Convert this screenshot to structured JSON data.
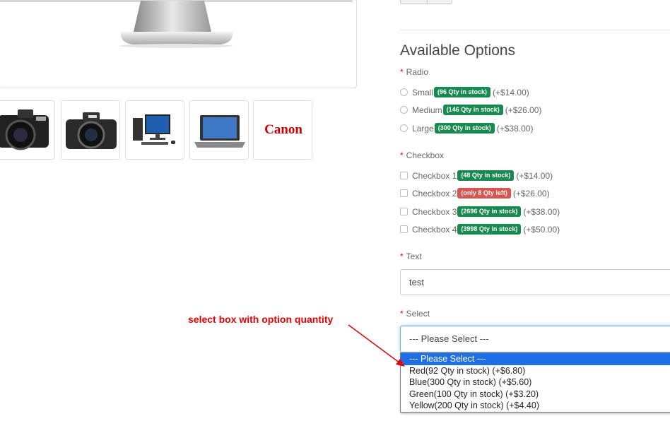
{
  "options": {
    "title": "Available Options",
    "radio": {
      "label": "Radio",
      "items": [
        {
          "name": "Small",
          "badge": "(96 Qty in stock)",
          "price": "(+$14.00)"
        },
        {
          "name": "Medium",
          "badge": "(146 Qty in stock)",
          "price": "(+$26.00)"
        },
        {
          "name": "Large",
          "badge": "(300 Qty in stock)",
          "price": "(+$38.00)"
        }
      ]
    },
    "checkbox": {
      "label": "Checkbox",
      "items": [
        {
          "name": "Checkbox 1",
          "badge": "(48 Qty in stock)",
          "price": "(+$14.00)",
          "badge_color": "#178a4f"
        },
        {
          "name": "Checkbox 2",
          "badge": "(only 8 Qty left)",
          "price": "(+$26.00)",
          "badge_color": "#d9534f"
        },
        {
          "name": "Checkbox 3",
          "badge": "(2696 Qty in stock)",
          "price": "(+$38.00)",
          "badge_color": "#178a4f"
        },
        {
          "name": "Checkbox 4",
          "badge": "(3998 Qty in stock)",
          "price": "(+$50.00)",
          "badge_color": "#178a4f"
        }
      ]
    },
    "text": {
      "label": "Text",
      "value": "test"
    },
    "select": {
      "label": "Select",
      "current": "--- Please Select ---",
      "options": [
        "--- Please Select ---",
        "Red(92 Qty in stock) (+$6.80)",
        "Blue(300 Qty in stock) (+$5.60)",
        "Green(100 Qty in stock) (+$3.20)",
        "Yellow(200 Qty in stock) (+$4.40)"
      ]
    },
    "required_marker": "*"
  },
  "thumbnails": [
    "camera-1-thumbnail",
    "camera-2-thumbnail",
    "desktop-pc-thumbnail",
    "laptop-thumbnail",
    "canon-logo-thumbnail"
  ],
  "canon_logo_text": "Canon",
  "annotation": "select box with option quantity",
  "colors": {
    "in_stock": "#178a4f",
    "low_stock": "#d9534f",
    "required": "#e01010",
    "annotation": "#e60000",
    "highlight": "#1e6ee6"
  }
}
